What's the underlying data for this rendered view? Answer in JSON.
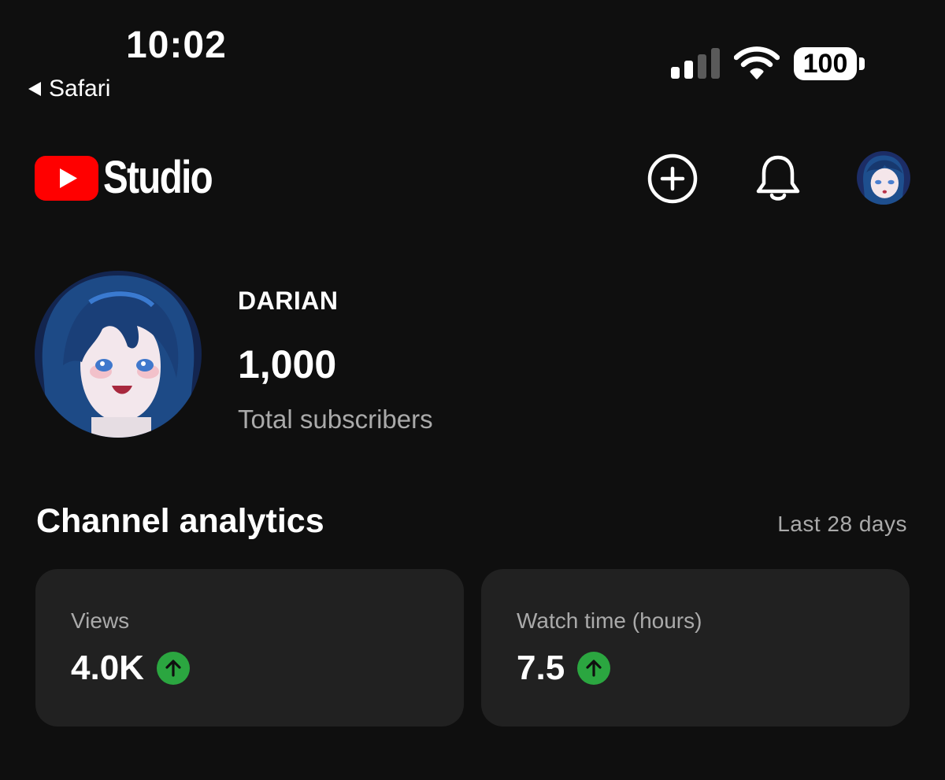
{
  "status_bar": {
    "time": "10:02",
    "back_app": "Safari",
    "battery": "100",
    "signal_icon": "cellular-signal-icon",
    "wifi_icon": "wifi-icon"
  },
  "header": {
    "brand": "Studio",
    "brand_color": "#ff0000",
    "actions": {
      "create_icon": "add-circle-icon",
      "notifications_icon": "bell-icon",
      "account_icon": "avatar"
    }
  },
  "channel": {
    "name": "DARIAN",
    "subscribers": "1,000",
    "subscribers_label": "Total subscribers"
  },
  "analytics": {
    "title": "Channel analytics",
    "period": "Last 28 days",
    "cards": [
      {
        "label": "Views",
        "value": "4.0K",
        "trend": "up",
        "trend_color": "#2ba640"
      },
      {
        "label": "Watch time (hours)",
        "value": "7.5",
        "trend": "up",
        "trend_color": "#2ba640"
      }
    ]
  }
}
